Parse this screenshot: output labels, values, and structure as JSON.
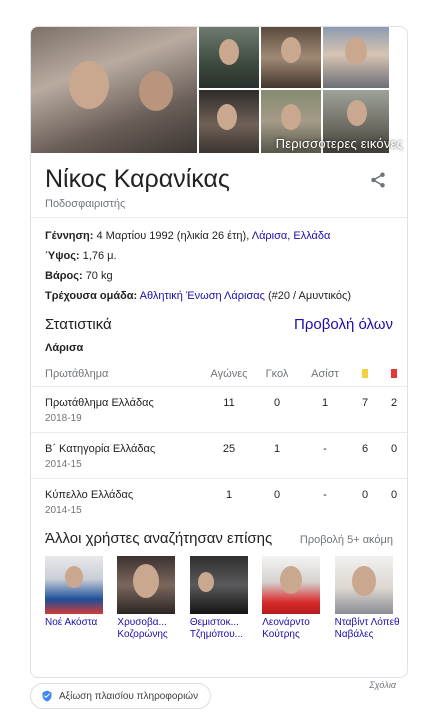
{
  "images": {
    "more_images_label": "Περισσότερες εικόνες"
  },
  "entity": {
    "title": "Νίκος Καρανίκας",
    "subtitle": "Ποδοσφαιριστής"
  },
  "facts": {
    "birth_label": "Γέννηση:",
    "birth_value": "4 Μαρτίου 1992 (ηλικία 26 έτη),",
    "birth_place": "Λάρισα, Ελλάδα",
    "height_label": "Ύψος:",
    "height_value": "1,76 μ.",
    "weight_label": "Βάρος:",
    "weight_value": "70 kg",
    "team_label": "Τρέχουσα ομάδα:",
    "team_link": "Αθλητική Ένωση Λάρισας",
    "team_extra": "(#20 / Αμυντικός)"
  },
  "stats": {
    "title": "Στατιστικά",
    "view_all": "Προβολή όλων",
    "team": "Λάρισα",
    "headers": {
      "competition": "Πρωτάθλημα",
      "apps": "Αγώνες",
      "goals": "Γκολ",
      "assists": "Ασίστ"
    },
    "colors": {
      "yellow": "#f4d03f",
      "red": "#e53935"
    },
    "rows": [
      {
        "competition": "Πρωτάθλημα Ελλάδας",
        "season": "2018-19",
        "apps": "11",
        "goals": "0",
        "assists": "1",
        "yellow": "7",
        "red": "2"
      },
      {
        "competition": "Β΄ Κατηγορία Ελλάδας",
        "season": "2014-15",
        "apps": "25",
        "goals": "1",
        "assists": "-",
        "yellow": "6",
        "red": "0"
      },
      {
        "competition": "Κύπελλο Ελλάδας",
        "season": "2014-15",
        "apps": "1",
        "goals": "0",
        "assists": "-",
        "yellow": "0",
        "red": "0"
      }
    ]
  },
  "people_also_search": {
    "title": "Άλλοι χρήστες αναζήτησαν επίσης",
    "more": "Προβολή 5+ ακόμη",
    "people": [
      {
        "name": "Νοέ Ακόστα"
      },
      {
        "name": "Χρυσοβα... Κοζορώνης"
      },
      {
        "name": "Θεμιστοκ... Τζημόπου..."
      },
      {
        "name": "Λεονάρντο Κούτρης"
      },
      {
        "name": "Νταβίντ Λόπεθ Ναβάλες"
      }
    ]
  },
  "footer": {
    "feedback": "Σχόλια",
    "claim": "Αξίωση πλαισίου πληροφοριών"
  }
}
